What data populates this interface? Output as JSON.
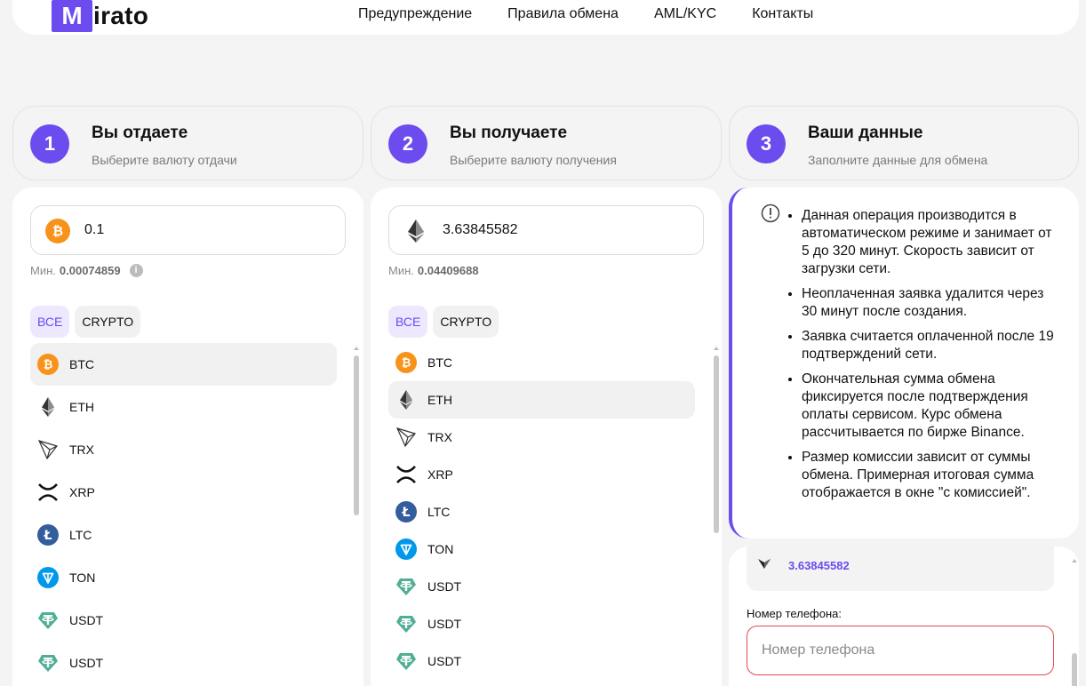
{
  "brand": {
    "logo_letter": "M",
    "logo_rest": "irato"
  },
  "nav": [
    "Предупреждение",
    "Правила обмена",
    "AML/KYC",
    "Контакты"
  ],
  "steps": [
    {
      "num": "1",
      "title": "Вы отдаете",
      "sub": "Выберите валюту отдачи"
    },
    {
      "num": "2",
      "title": "Вы получаете",
      "sub": "Выберите валюту получения"
    },
    {
      "num": "3",
      "title": "Ваши данные",
      "sub": "Заполните данные для обмена"
    }
  ],
  "give": {
    "amount": "0.1",
    "min_label": "Мин.",
    "min_value": "0.00074859",
    "filters": [
      "ВСЕ",
      "CRYPTO"
    ],
    "coins": [
      {
        "name": "BTC",
        "icon": "btc-icon"
      },
      {
        "name": "ETH",
        "icon": "eth-icon"
      },
      {
        "name": "TRX",
        "icon": "trx-icon"
      },
      {
        "name": "XRP",
        "icon": "xrp-icon"
      },
      {
        "name": "LTC",
        "icon": "ltc-icon"
      },
      {
        "name": "TON",
        "icon": "ton-icon"
      },
      {
        "name": "USDT",
        "icon": "usdt-icon"
      },
      {
        "name": "USDT",
        "icon": "usdt-icon"
      }
    ],
    "selected": "BTC"
  },
  "get": {
    "amount": "3.63845582",
    "min_label": "Мин.",
    "min_value": "0.04409688",
    "filters": [
      "ВСЕ",
      "CRYPTO"
    ],
    "coins": [
      {
        "name": "BTC",
        "icon": "btc-icon"
      },
      {
        "name": "ETH",
        "icon": "eth-icon"
      },
      {
        "name": "TRX",
        "icon": "trx-icon"
      },
      {
        "name": "XRP",
        "icon": "xrp-icon"
      },
      {
        "name": "LTC",
        "icon": "ltc-icon"
      },
      {
        "name": "TON",
        "icon": "ton-icon"
      },
      {
        "name": "USDT",
        "icon": "usdt-icon"
      },
      {
        "name": "USDT",
        "icon": "usdt-icon"
      },
      {
        "name": "USDT",
        "icon": "usdt-icon"
      }
    ],
    "selected": "ETH"
  },
  "info": {
    "items": [
      "Данная операция производится в автоматическом режиме и занимает от 5 до 320 минут. Скорость зависит от загрузки сети.",
      "Неоплаченная заявка удалится через 30 минут после создания.",
      "Заявка считается оплаченной после 19 подтверждений сети.",
      "Окончательная сумма обмена фиксируется после подтверждения оплаты сервисом. Курс обмена рассчитывается по бирже Binance.",
      "Размер комиссии зависит от суммы обмена. Примерная итоговая сумма отображается в окне \"с комиссией\"."
    ]
  },
  "data_form": {
    "receive_value": "3.63845582",
    "phone_label": "Номер телефона:",
    "phone_placeholder": "Номер телефона",
    "phone_value": ""
  },
  "colors": {
    "accent": "#6c4bef",
    "error": "#e04a4a",
    "btc": "#f7931a",
    "ltc": "#345d9d",
    "ton": "#0098ea",
    "usdt": "#50af95"
  }
}
